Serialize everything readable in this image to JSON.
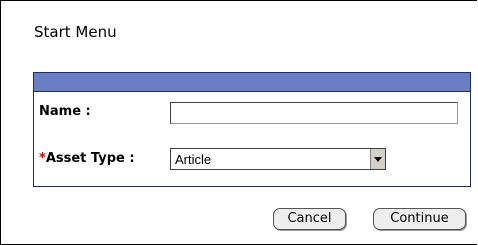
{
  "dialog": {
    "title": "Start Menu"
  },
  "form": {
    "name_label": "Name :",
    "name_value": "",
    "asset_required_marker": "*",
    "asset_type_label": "Asset Type :",
    "asset_type_selected": "Article"
  },
  "buttons": {
    "cancel_label": "Cancel",
    "continue_label": "Continue"
  },
  "colors": {
    "panel_header": "#6a7fc3",
    "panel_border": "#1c2c6e",
    "required_marker": "#cc0000"
  }
}
